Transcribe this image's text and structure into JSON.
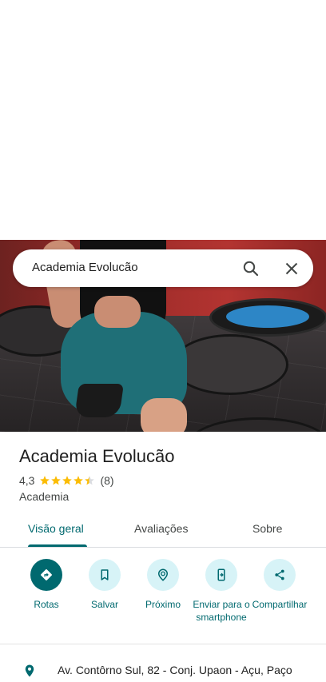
{
  "search": {
    "query": "Academia Evolucão"
  },
  "place": {
    "name": "Academia Evolucão",
    "rating": "4,3",
    "rating_value": 4.3,
    "review_count": "(8)",
    "category": "Academia"
  },
  "tabs": [
    {
      "label": "Visão geral",
      "active": true
    },
    {
      "label": "Avaliações",
      "active": false
    },
    {
      "label": "Sobre",
      "active": false
    }
  ],
  "actions": [
    {
      "label": "Rotas",
      "icon": "directions-icon"
    },
    {
      "label": "Salvar",
      "icon": "bookmark-icon"
    },
    {
      "label": "Próximo",
      "icon": "nearby-icon"
    },
    {
      "label": "Enviar para o smartphone",
      "icon": "send-to-phone-icon"
    },
    {
      "label": "Compartilhar",
      "icon": "share-icon"
    }
  ],
  "address": {
    "text": "Av. Contôrno Sul, 82 - Conj. Upaon - Açu, Paço"
  },
  "colors": {
    "accent": "#00696f",
    "accent_light": "#d7f3f7",
    "star": "#fbbc04"
  }
}
